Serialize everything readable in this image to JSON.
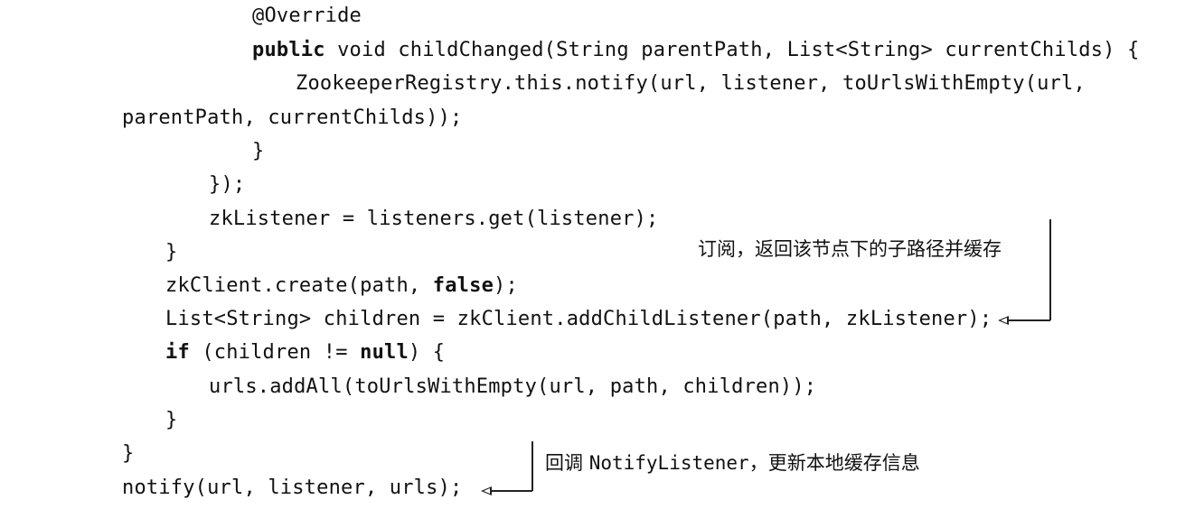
{
  "code_lines": [
    {
      "segments": [
        {
          "text": "@Override",
          "bold": false
        }
      ]
    },
    {
      "segments": [
        {
          "text": "public",
          "bold": true
        },
        {
          "text": " void childChanged(String parentPath, List<String> currentChilds) {",
          "bold": false
        }
      ]
    },
    {
      "segments": [
        {
          "text": "ZookeeperRegistry.this.notify(url, listener, toUrlsWithEmpty(url,",
          "bold": false
        }
      ]
    },
    {
      "segments": [
        {
          "text": "parentPath, currentChilds));",
          "bold": false
        }
      ]
    },
    {
      "segments": [
        {
          "text": "}",
          "bold": false
        }
      ]
    },
    {
      "segments": [
        {
          "text": "});",
          "bold": false
        }
      ]
    },
    {
      "segments": [
        {
          "text": "zkListener = listeners.get(listener);",
          "bold": false
        }
      ]
    },
    {
      "segments": [
        {
          "text": "}",
          "bold": false
        }
      ]
    },
    {
      "segments": [
        {
          "text": "zkClient.create(path, ",
          "bold": false
        },
        {
          "text": "false",
          "bold": true
        },
        {
          "text": ");",
          "bold": false
        }
      ]
    },
    {
      "segments": [
        {
          "text": "List<String> children = zkClient.addChildListener(path, zkListener);",
          "bold": false
        }
      ]
    },
    {
      "segments": [
        {
          "text": "if",
          "bold": true
        },
        {
          "text": " (children != ",
          "bold": false
        },
        {
          "text": "null",
          "bold": true
        },
        {
          "text": ") {",
          "bold": false
        }
      ]
    },
    {
      "segments": [
        {
          "text": "urls.addAll(toUrlsWithEmpty(url, path, children));",
          "bold": false
        }
      ]
    },
    {
      "segments": [
        {
          "text": "}",
          "bold": false
        }
      ]
    },
    {
      "segments": [
        {
          "text": "}",
          "bold": false
        }
      ]
    },
    {
      "segments": [
        {
          "text": "notify(url, listener, urls);",
          "bold": false
        }
      ]
    }
  ],
  "annotations": {
    "subscribe": "订阅，返回该节点下的子路径并缓存",
    "callback_prefix": "回调 ",
    "callback_mono": "NotifyListener",
    "callback_suffix": "，更新本地缓存信息"
  }
}
